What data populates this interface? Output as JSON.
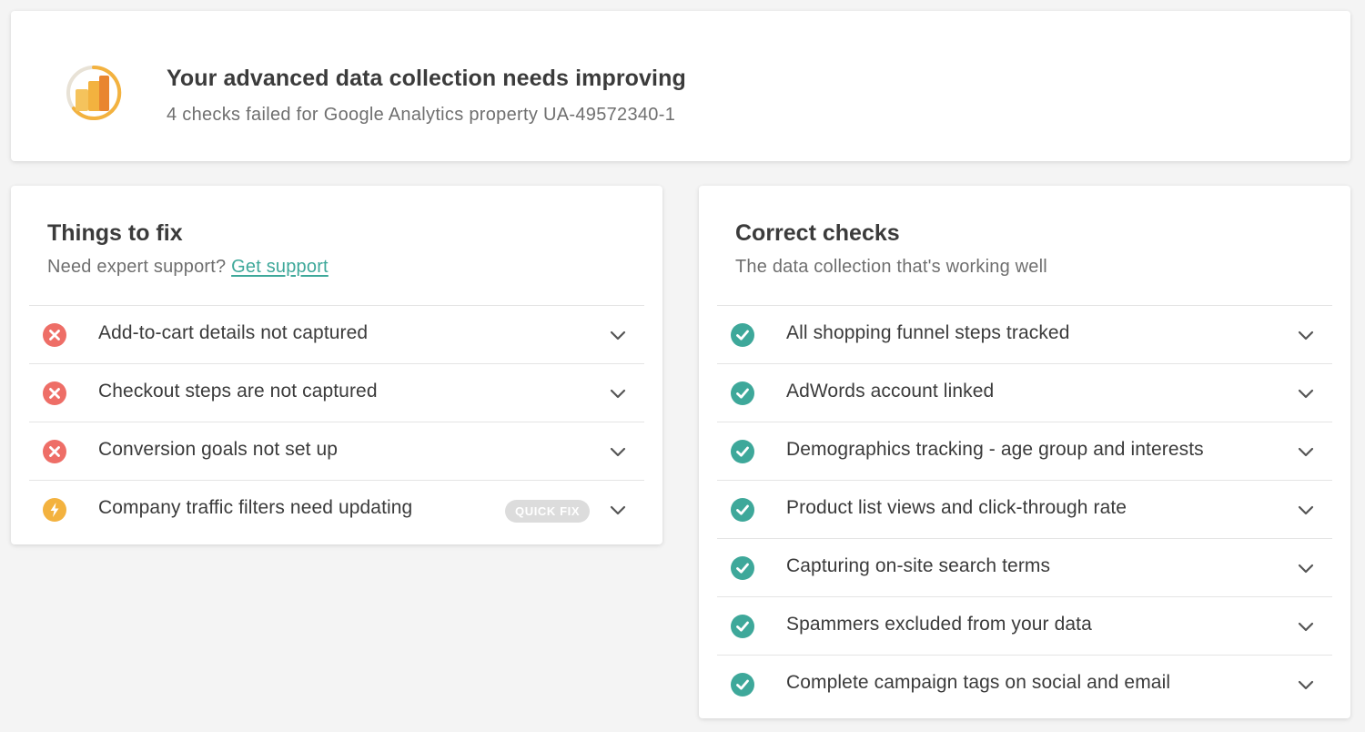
{
  "header": {
    "title": "Your advanced data collection needs improving",
    "subtitle": "4 checks failed for Google Analytics property UA-49572340-1",
    "icon": "analytics-bar-chart-icon"
  },
  "fix_panel": {
    "title": "Things to fix",
    "subtitle_prefix": "Need expert support?",
    "support_link": "Get support",
    "items": [
      {
        "label": "Add-to-cart details not captured",
        "status": "error"
      },
      {
        "label": "Checkout steps are not captured",
        "status": "error"
      },
      {
        "label": "Conversion goals not set up",
        "status": "error"
      },
      {
        "label": "Company traffic filters need updating",
        "status": "warning",
        "badge": "QUICK FIX"
      }
    ]
  },
  "correct_panel": {
    "title": "Correct checks",
    "subtitle": "The data collection that's working well",
    "items": [
      {
        "label": "All shopping funnel steps tracked",
        "status": "ok"
      },
      {
        "label": "AdWords account linked",
        "status": "ok"
      },
      {
        "label": "Demographics tracking - age group and interests",
        "status": "ok"
      },
      {
        "label": "Product list views and click-through rate",
        "status": "ok"
      },
      {
        "label": "Capturing on-site search terms",
        "status": "ok"
      },
      {
        "label": "Spammers excluded from your data",
        "status": "ok"
      },
      {
        "label": "Complete campaign tags on social and email",
        "status": "ok"
      }
    ]
  },
  "colors": {
    "error": "#ee6e67",
    "warning": "#f3b23f",
    "ok": "#3ea89a",
    "link": "#3ea89a",
    "badge_bg": "#dcdcdc"
  }
}
